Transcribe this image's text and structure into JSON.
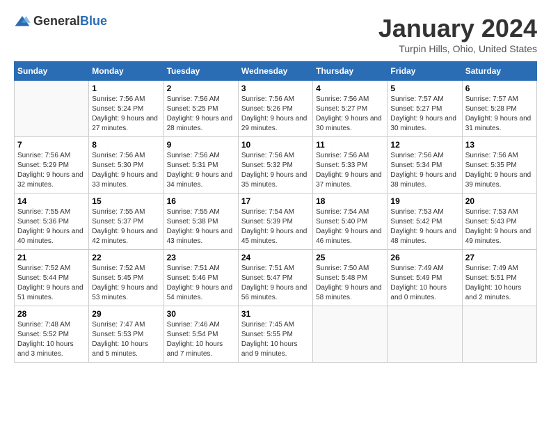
{
  "header": {
    "logo_general": "General",
    "logo_blue": "Blue",
    "title": "January 2024",
    "subtitle": "Turpin Hills, Ohio, United States"
  },
  "calendar": {
    "days_of_week": [
      "Sunday",
      "Monday",
      "Tuesday",
      "Wednesday",
      "Thursday",
      "Friday",
      "Saturday"
    ],
    "weeks": [
      [
        {
          "day": "",
          "details": ""
        },
        {
          "day": "1",
          "details": "Sunrise: 7:56 AM\nSunset: 5:24 PM\nDaylight: 9 hours and 27 minutes."
        },
        {
          "day": "2",
          "details": "Sunrise: 7:56 AM\nSunset: 5:25 PM\nDaylight: 9 hours and 28 minutes."
        },
        {
          "day": "3",
          "details": "Sunrise: 7:56 AM\nSunset: 5:26 PM\nDaylight: 9 hours and 29 minutes."
        },
        {
          "day": "4",
          "details": "Sunrise: 7:56 AM\nSunset: 5:27 PM\nDaylight: 9 hours and 30 minutes."
        },
        {
          "day": "5",
          "details": "Sunrise: 7:57 AM\nSunset: 5:27 PM\nDaylight: 9 hours and 30 minutes."
        },
        {
          "day": "6",
          "details": "Sunrise: 7:57 AM\nSunset: 5:28 PM\nDaylight: 9 hours and 31 minutes."
        }
      ],
      [
        {
          "day": "7",
          "details": "Sunrise: 7:56 AM\nSunset: 5:29 PM\nDaylight: 9 hours and 32 minutes."
        },
        {
          "day": "8",
          "details": "Sunrise: 7:56 AM\nSunset: 5:30 PM\nDaylight: 9 hours and 33 minutes."
        },
        {
          "day": "9",
          "details": "Sunrise: 7:56 AM\nSunset: 5:31 PM\nDaylight: 9 hours and 34 minutes."
        },
        {
          "day": "10",
          "details": "Sunrise: 7:56 AM\nSunset: 5:32 PM\nDaylight: 9 hours and 35 minutes."
        },
        {
          "day": "11",
          "details": "Sunrise: 7:56 AM\nSunset: 5:33 PM\nDaylight: 9 hours and 37 minutes."
        },
        {
          "day": "12",
          "details": "Sunrise: 7:56 AM\nSunset: 5:34 PM\nDaylight: 9 hours and 38 minutes."
        },
        {
          "day": "13",
          "details": "Sunrise: 7:56 AM\nSunset: 5:35 PM\nDaylight: 9 hours and 39 minutes."
        }
      ],
      [
        {
          "day": "14",
          "details": "Sunrise: 7:55 AM\nSunset: 5:36 PM\nDaylight: 9 hours and 40 minutes."
        },
        {
          "day": "15",
          "details": "Sunrise: 7:55 AM\nSunset: 5:37 PM\nDaylight: 9 hours and 42 minutes."
        },
        {
          "day": "16",
          "details": "Sunrise: 7:55 AM\nSunset: 5:38 PM\nDaylight: 9 hours and 43 minutes."
        },
        {
          "day": "17",
          "details": "Sunrise: 7:54 AM\nSunset: 5:39 PM\nDaylight: 9 hours and 45 minutes."
        },
        {
          "day": "18",
          "details": "Sunrise: 7:54 AM\nSunset: 5:40 PM\nDaylight: 9 hours and 46 minutes."
        },
        {
          "day": "19",
          "details": "Sunrise: 7:53 AM\nSunset: 5:42 PM\nDaylight: 9 hours and 48 minutes."
        },
        {
          "day": "20",
          "details": "Sunrise: 7:53 AM\nSunset: 5:43 PM\nDaylight: 9 hours and 49 minutes."
        }
      ],
      [
        {
          "day": "21",
          "details": "Sunrise: 7:52 AM\nSunset: 5:44 PM\nDaylight: 9 hours and 51 minutes."
        },
        {
          "day": "22",
          "details": "Sunrise: 7:52 AM\nSunset: 5:45 PM\nDaylight: 9 hours and 53 minutes."
        },
        {
          "day": "23",
          "details": "Sunrise: 7:51 AM\nSunset: 5:46 PM\nDaylight: 9 hours and 54 minutes."
        },
        {
          "day": "24",
          "details": "Sunrise: 7:51 AM\nSunset: 5:47 PM\nDaylight: 9 hours and 56 minutes."
        },
        {
          "day": "25",
          "details": "Sunrise: 7:50 AM\nSunset: 5:48 PM\nDaylight: 9 hours and 58 minutes."
        },
        {
          "day": "26",
          "details": "Sunrise: 7:49 AM\nSunset: 5:49 PM\nDaylight: 10 hours and 0 minutes."
        },
        {
          "day": "27",
          "details": "Sunrise: 7:49 AM\nSunset: 5:51 PM\nDaylight: 10 hours and 2 minutes."
        }
      ],
      [
        {
          "day": "28",
          "details": "Sunrise: 7:48 AM\nSunset: 5:52 PM\nDaylight: 10 hours and 3 minutes."
        },
        {
          "day": "29",
          "details": "Sunrise: 7:47 AM\nSunset: 5:53 PM\nDaylight: 10 hours and 5 minutes."
        },
        {
          "day": "30",
          "details": "Sunrise: 7:46 AM\nSunset: 5:54 PM\nDaylight: 10 hours and 7 minutes."
        },
        {
          "day": "31",
          "details": "Sunrise: 7:45 AM\nSunset: 5:55 PM\nDaylight: 10 hours and 9 minutes."
        },
        {
          "day": "",
          "details": ""
        },
        {
          "day": "",
          "details": ""
        },
        {
          "day": "",
          "details": ""
        }
      ]
    ]
  }
}
